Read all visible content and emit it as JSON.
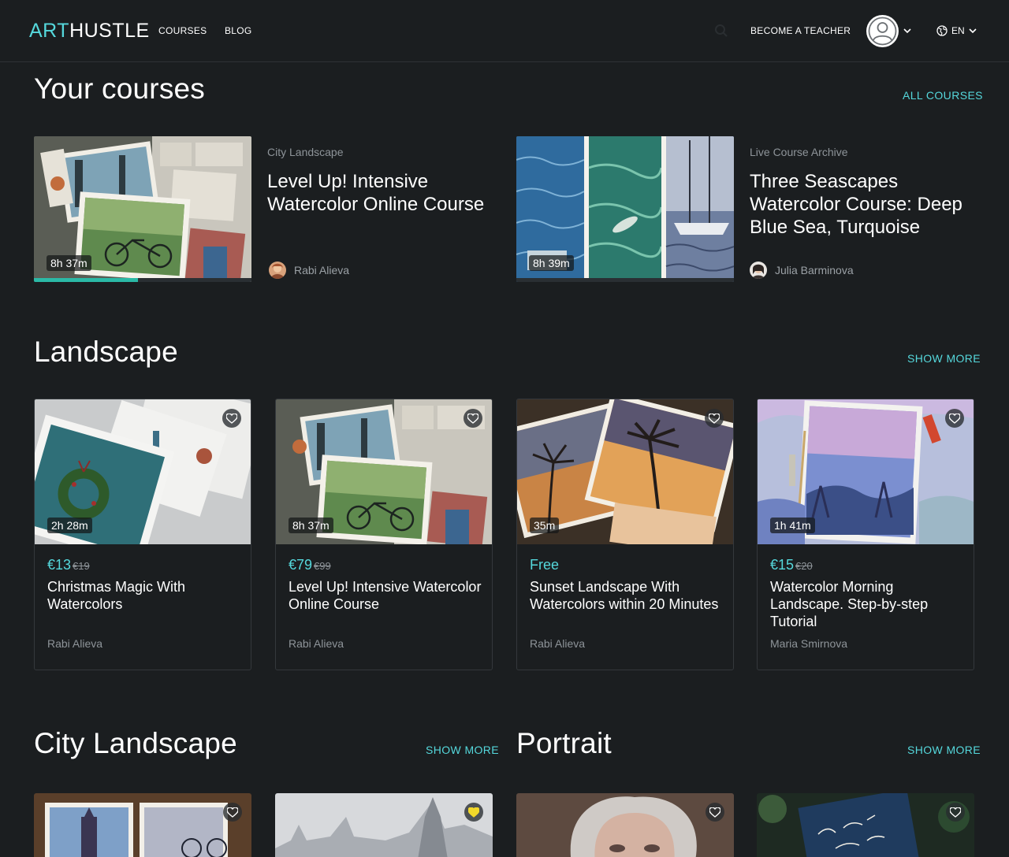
{
  "header": {
    "logo_part1": "ART",
    "logo_part2": "HUSTLE",
    "nav": [
      "COURSES",
      "BLOG"
    ],
    "teacher_link": "BECOME A TEACHER",
    "language": "EN"
  },
  "your_courses": {
    "title": "Your courses",
    "link": "ALL COURSES",
    "items": [
      {
        "category": "City Landscape",
        "title": "Level Up! Intensive Watercolor Online Course",
        "author": "Rabi Alieva",
        "duration": "8h 37m",
        "progress": 0.48
      },
      {
        "category": "Live Course Archive",
        "title": "Three Seascapes Watercolor Course: Deep Blue Sea, Turquoise",
        "author": "Julia Barminova",
        "duration": "8h 39m",
        "progress": 0
      }
    ]
  },
  "landscape": {
    "title": "Landscape",
    "link": "SHOW MORE",
    "cards": [
      {
        "duration": "2h 28m",
        "price": "€13",
        "old_price": "€19",
        "title": "Christmas Magic With Watercolors",
        "author": "Rabi Alieva"
      },
      {
        "duration": "8h 37m",
        "price": "€79",
        "old_price": "€99",
        "title": "Level Up! Intensive Watercolor Online Course",
        "author": "Rabi Alieva"
      },
      {
        "duration": "35m",
        "price": "Free",
        "old_price": "",
        "title": "Sunset Landscape With Watercolors within 20 Minutes",
        "author": "Rabi Alieva"
      },
      {
        "duration": "1h 41m",
        "price": "€15",
        "old_price": "€20",
        "title": "Watercolor Morning Landscape. Step-by-step Tutorial",
        "author": "Maria Smirnova"
      }
    ]
  },
  "city_landscape": {
    "title": "City Landscape",
    "link": "SHOW MORE"
  },
  "portrait": {
    "title": "Portrait",
    "link": "SHOW MORE"
  },
  "colors": {
    "accent": "#55d8dc",
    "background": "#1b1e20",
    "progress": "#2bb9a6",
    "heart_active": "#f2d82a"
  },
  "icons": [
    "search-icon",
    "user-avatar-icon",
    "chevron-down-icon",
    "globe-icon",
    "heart-icon"
  ]
}
